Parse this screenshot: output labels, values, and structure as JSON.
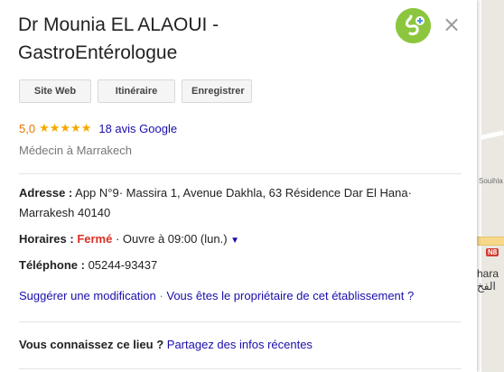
{
  "listing": {
    "title": "Dr Mounia EL ALAOUI - GastroEntérologue",
    "buttons": {
      "website": "Site Web",
      "directions": "Itinéraire",
      "save": "Enregistrer"
    },
    "rating": {
      "score": "5,0",
      "stars": "★★★★★",
      "reviews": "18 avis Google"
    },
    "category": "Médecin à Marrakech",
    "address": {
      "label": "Adresse :",
      "value": "App N°9· Massira 1, Avenue Dakhla, 63 Résidence Dar El Hana· Marrakesh 40140"
    },
    "hours": {
      "label": "Horaires :",
      "status": "Fermé",
      "next": "· Ouvre à 09:00 (lun.)"
    },
    "phone": {
      "label": "Téléphone :",
      "value": "05244-93437"
    },
    "suggest_edit": "Suggérer une modification",
    "separator": "·",
    "owner_link": "Vous êtes le propriétaire de cet établissement ?",
    "know_label": "Vous connaissez ce lieu ?",
    "share_link": "Partagez des infos récentes"
  },
  "map": {
    "label_top": "Souihla",
    "shield": "N8",
    "place_latin": "hara",
    "place_arabic": "الفخ"
  },
  "icons": {
    "logo": "gastro-logo-icon",
    "close": "close-icon",
    "dropdown": "chevron-down-icon"
  },
  "colors": {
    "link": "#1a0dab",
    "closed": "#d93025",
    "star": "#f4a900",
    "score": "#e37400",
    "logo_green": "#8cc63e"
  }
}
